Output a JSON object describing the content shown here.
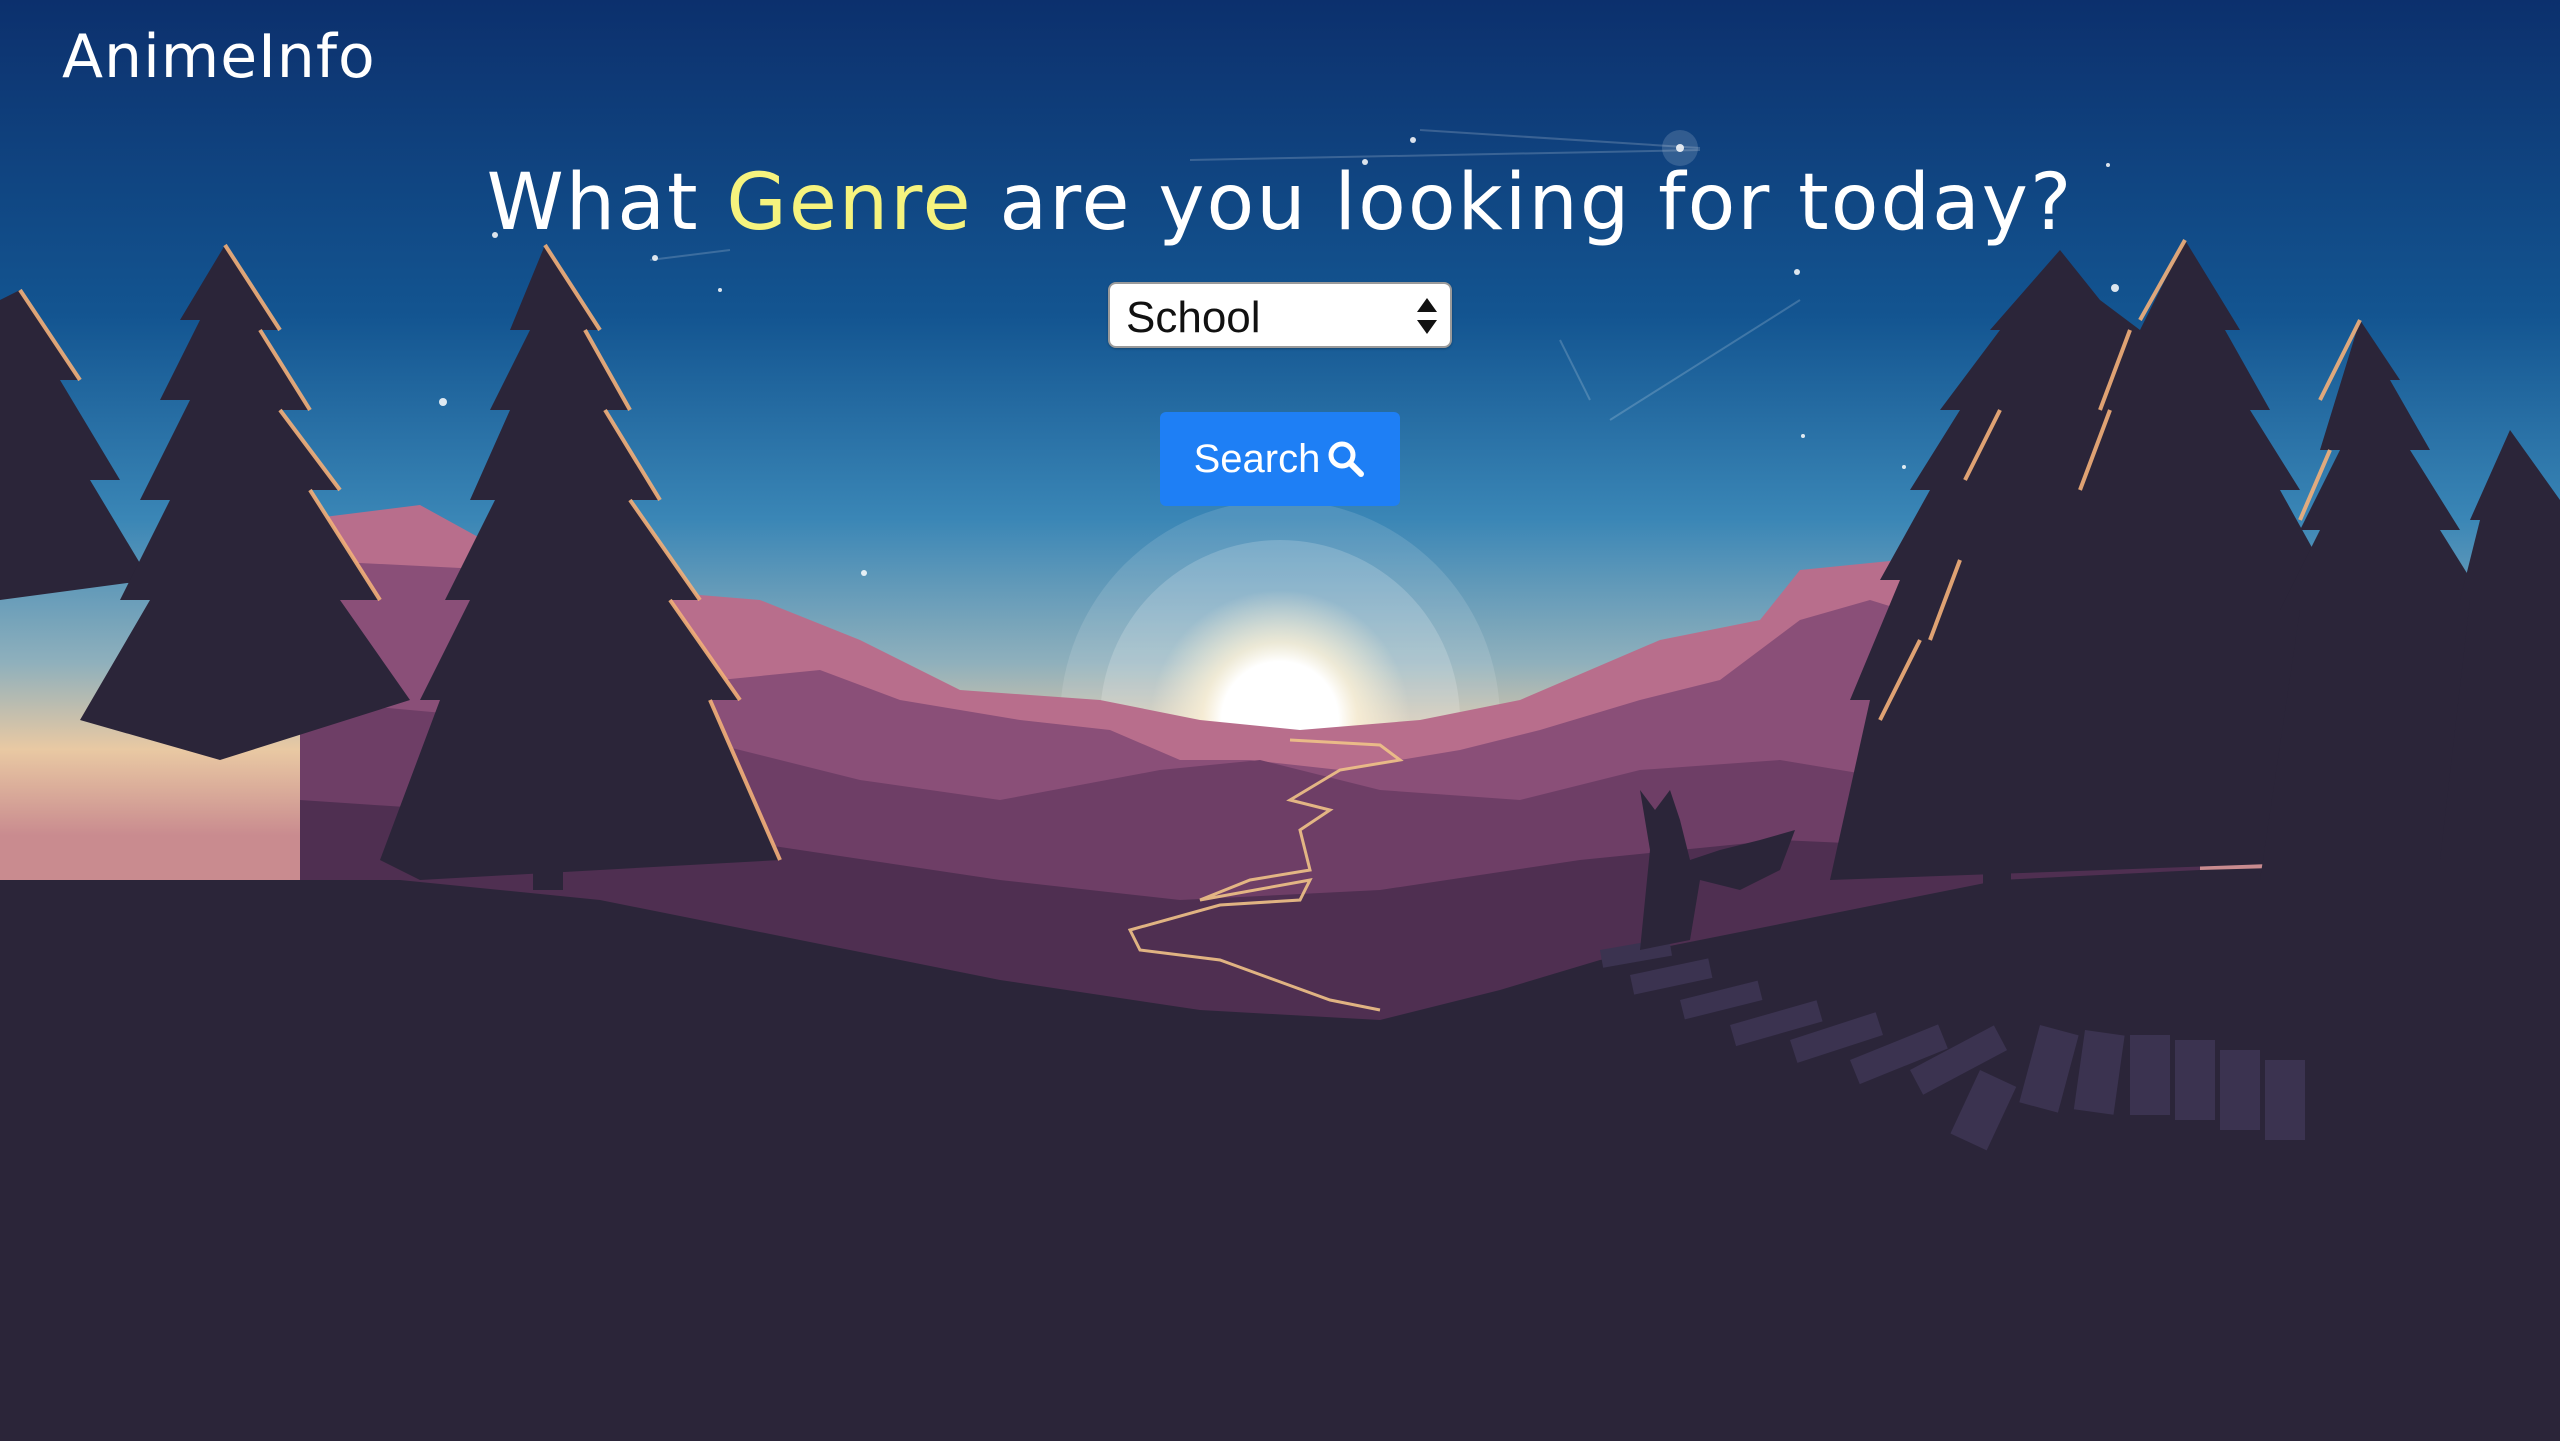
{
  "header": {
    "brand": "AnimeInfo"
  },
  "hero": {
    "headline_before": "What ",
    "headline_accent": "Genre",
    "headline_after": " are you looking for today?"
  },
  "genre_select": {
    "selected": "School"
  },
  "search_button": {
    "label": "Search",
    "icon": "search-icon"
  },
  "colors": {
    "accent_text": "#f6f37e",
    "button": "#1e7ff5",
    "sky_top": "#0c306d",
    "ground": "#2b2539"
  }
}
